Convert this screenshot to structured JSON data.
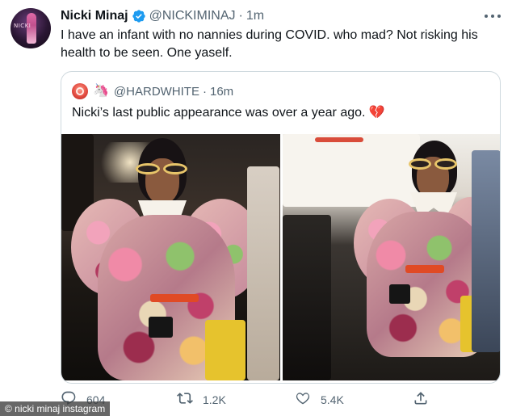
{
  "tweet": {
    "name": "Nicki Minaj",
    "verified": true,
    "handle": "@NICKIMINAJ",
    "separator": "·",
    "time": "1m",
    "text": "I have an infant with no nannies during COVID. who mad? Not risking his health to be seen. One yaself.",
    "avatar_text": "NICKI"
  },
  "quoted": {
    "unicorn": "🦄",
    "handle": "@HARDWHITE",
    "separator": "·",
    "time": "16m",
    "text": "Nicki’s last public appearance was over a year ago.",
    "emoji": "💔"
  },
  "actions": {
    "replies": "604",
    "retweets": "1.2K",
    "likes": "5.4K"
  },
  "icons": {
    "verified": "verified-badge-icon",
    "more": "more-horizontal-icon",
    "reply": "reply-icon",
    "retweet": "retweet-icon",
    "like": "like-icon",
    "share": "share-icon"
  },
  "colors": {
    "primary_text": "#0f1419",
    "secondary_text": "#536471",
    "verified": "#1d9bf0",
    "border": "#cfd9de"
  },
  "credit": "© nicki minaj instagram"
}
